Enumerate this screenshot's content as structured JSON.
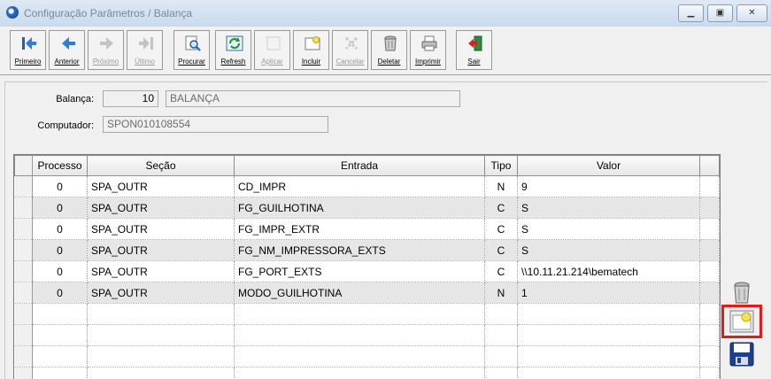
{
  "window": {
    "title": "Configuração Parâmetros / Balança",
    "minimize_icon": "minimize-icon",
    "maximize_icon": "maximize-icon",
    "close_icon": "close-icon"
  },
  "toolbar": {
    "buttons": [
      {
        "label": "Primeiro",
        "icon": "first-record-icon",
        "enabled": true
      },
      {
        "label": "Anterior",
        "icon": "previous-record-icon",
        "enabled": true
      },
      {
        "label": "Próximo",
        "icon": "next-record-icon",
        "enabled": false
      },
      {
        "label": "Último",
        "icon": "last-record-icon",
        "enabled": false
      },
      {
        "label": "Procurar",
        "icon": "search-icon",
        "enabled": true
      },
      {
        "label": "Refresh",
        "icon": "refresh-icon",
        "enabled": true
      },
      {
        "label": "Aplicar",
        "icon": "apply-icon",
        "enabled": false
      },
      {
        "label": "Incluir",
        "icon": "add-icon",
        "enabled": true
      },
      {
        "label": "Cancelar",
        "icon": "cancel-icon",
        "enabled": false
      },
      {
        "label": "Deletar",
        "icon": "trash-icon",
        "enabled": true
      },
      {
        "label": "Imprimir",
        "icon": "printer-icon",
        "enabled": true
      },
      {
        "label": "Sair",
        "icon": "exit-icon",
        "enabled": true
      }
    ]
  },
  "form": {
    "balanca_label": "Balança:",
    "balanca_code": "10",
    "balanca_name": "BALANÇA",
    "computador_label": "Computador:",
    "computador_value": "SPON010108554"
  },
  "grid": {
    "columns": [
      "Processo",
      "Seção",
      "Entrada",
      "Tipo",
      "Valor"
    ],
    "rows": [
      [
        "0",
        "SPA_OUTR",
        "CD_IMPR",
        "N",
        "9"
      ],
      [
        "0",
        "SPA_OUTR",
        "FG_GUILHOTINA",
        "C",
        "S"
      ],
      [
        "0",
        "SPA_OUTR",
        "FG_IMPR_EXTR",
        "C",
        "S"
      ],
      [
        "0",
        "SPA_OUTR",
        "FG_NM_IMPRESSORA_EXTS",
        "C",
        "S"
      ],
      [
        "0",
        "SPA_OUTR",
        "FG_PORT_EXTS",
        "C",
        "\\\\10.11.21.214\\bematech"
      ],
      [
        "0",
        "SPA_OUTR",
        "MODO_GUILHOTINA",
        "N",
        "1"
      ]
    ],
    "empty_rows": 4
  },
  "side_buttons": [
    {
      "icon": "trash-icon"
    },
    {
      "icon": "add-row-icon"
    },
    {
      "icon": "save-icon"
    }
  ],
  "colors": {
    "highlight": "#e11b1b",
    "alt_row": "#e6e6e6"
  }
}
